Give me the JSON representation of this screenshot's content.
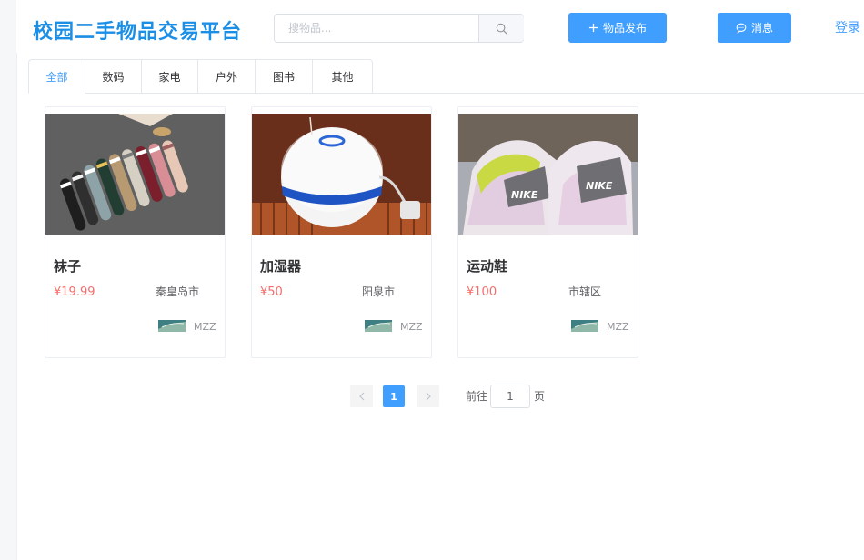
{
  "header": {
    "site_title": "校园二手物品交易平台",
    "search_placeholder": "搜物品...",
    "publish_label": "物品发布",
    "message_label": "消息",
    "login_label": "登录"
  },
  "tabs": [
    {
      "label": "全部",
      "active": true
    },
    {
      "label": "数码"
    },
    {
      "label": "家电"
    },
    {
      "label": "户外"
    },
    {
      "label": "图书"
    },
    {
      "label": "其他"
    }
  ],
  "products": [
    {
      "name": "袜子",
      "price": "¥19.99",
      "city": "秦皇岛市",
      "seller": "MZZ",
      "image_icon": "socks-photo"
    },
    {
      "name": "加湿器",
      "price": "¥50",
      "city": "阳泉市",
      "seller": "MZZ",
      "image_icon": "humidifier-photo"
    },
    {
      "name": "运动鞋",
      "price": "¥100",
      "city": "市辖区",
      "seller": "MZZ",
      "image_icon": "sneakers-photo"
    }
  ],
  "pagination": {
    "current_page": "1",
    "goto_label": "前往",
    "goto_value": "1",
    "goto_suffix": "页"
  },
  "colors": {
    "brand": "#1b8ee6",
    "primary": "#409eff",
    "price": "#f56c6c"
  }
}
